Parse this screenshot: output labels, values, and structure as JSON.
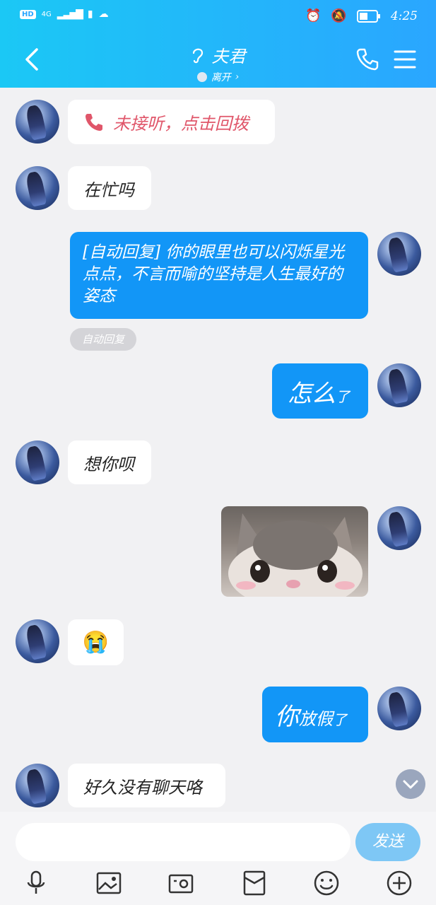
{
  "status_bar": {
    "hd": "HD",
    "network": "4G",
    "time": "4:25"
  },
  "header": {
    "title": "夫君",
    "presence": "离开"
  },
  "messages": {
    "missed_call": "未接听，点击回拨",
    "m1": "在忙吗",
    "auto_reply": "[自动回复] 你的眼里也可以闪烁星光点点，不言而喻的坚持是人生最好的姿态",
    "auto_tag": "自动回复",
    "m3_big": "怎么",
    "m3_small": "了",
    "m4": "想你呗",
    "m5_emoji": "😭",
    "m6_big": "你",
    "m6_mid": "放假",
    "m6_small": "了",
    "m7": "好久没有聊天咯"
  },
  "input": {
    "placeholder": "",
    "send_label": "发送"
  },
  "toolbar": [
    "mic-icon",
    "image-icon",
    "camera-icon",
    "red-packet-icon",
    "emoji-icon",
    "plus-icon"
  ],
  "colors": {
    "header_start": "#1bc8f5",
    "header_end": "#2aa6ff",
    "outgoing_bubble": "#1296f7",
    "missed_call": "#e0566a"
  }
}
